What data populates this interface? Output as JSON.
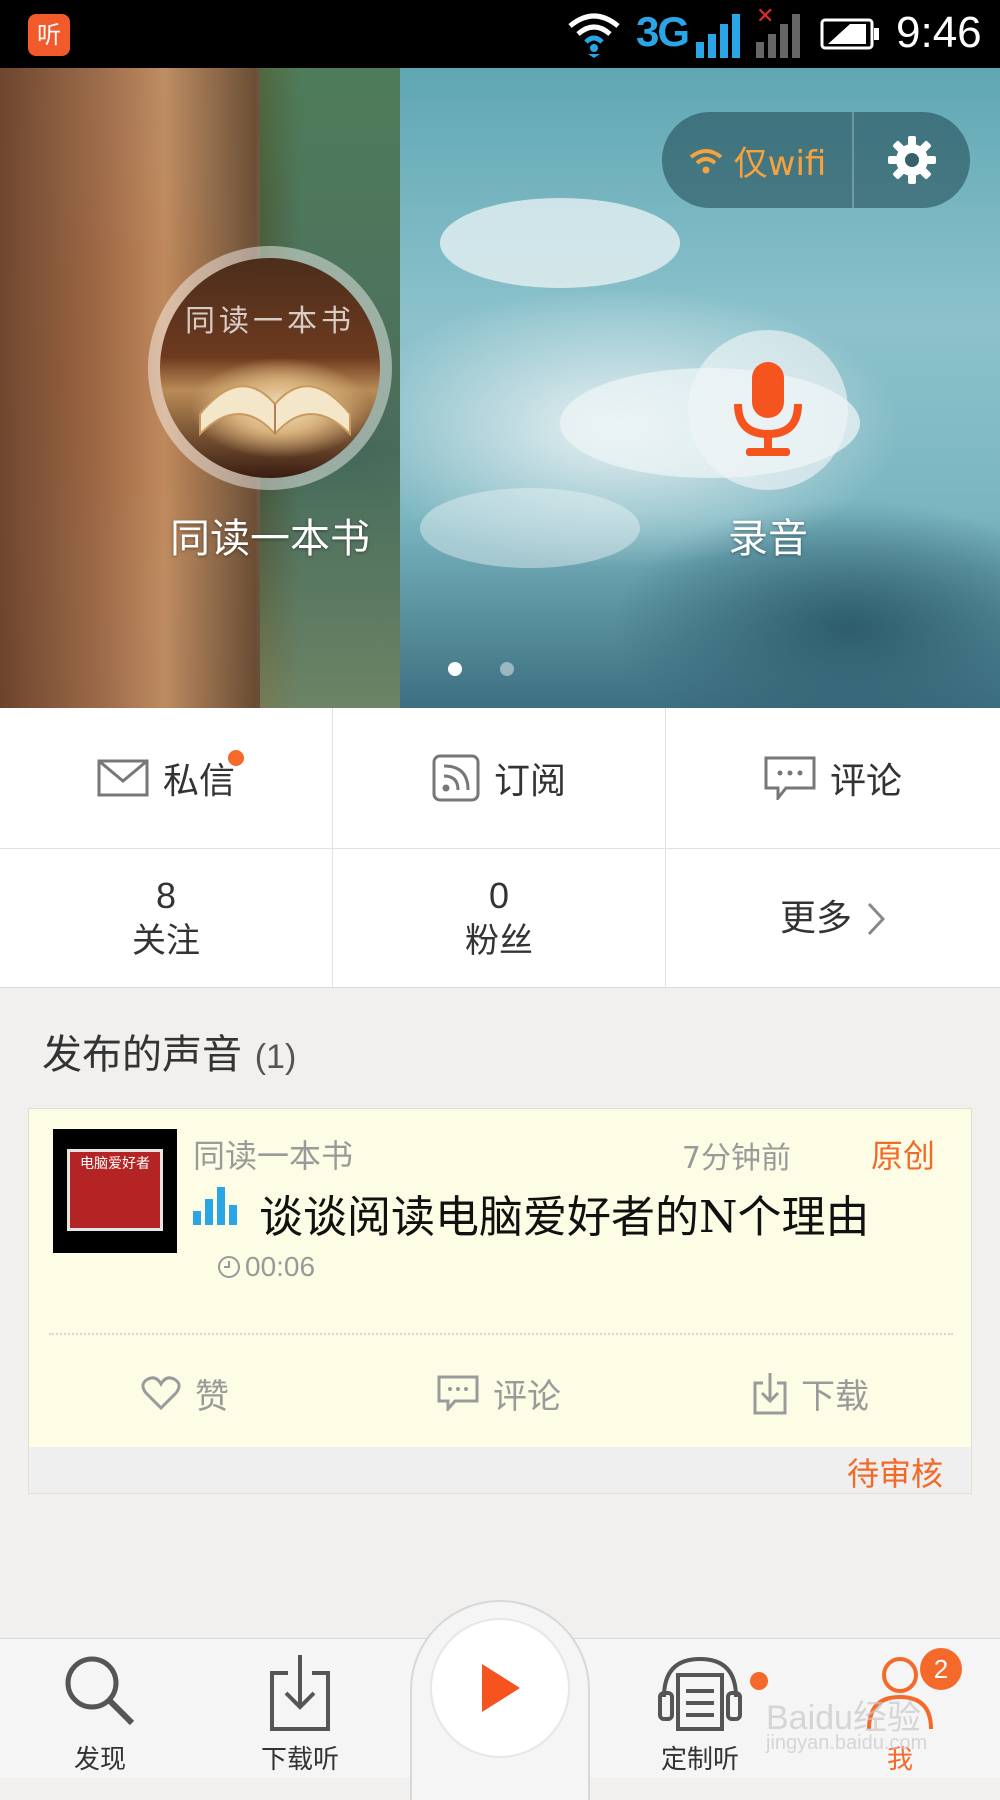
{
  "status_bar": {
    "app_icon_glyph": "听",
    "network": "3G",
    "time": "9:46"
  },
  "hero": {
    "wifi_only_label": "仅wifi",
    "username": "同读一本书",
    "avatar_text": "同读一本书",
    "record_label": "录音",
    "page_indicator": {
      "total": 2,
      "active": 1
    }
  },
  "actions": {
    "messages": "私信",
    "subscribe": "订阅",
    "comments": "评论"
  },
  "stats": {
    "following_count": "8",
    "following_label": "关注",
    "fans_count": "0",
    "fans_label": "粉丝",
    "more_label": "更多"
  },
  "published": {
    "title": "发布的声音",
    "count": "(1)",
    "items": [
      {
        "author": "同读一本书",
        "time_ago": "7分钟前",
        "original_tag": "原创",
        "title": "谈谈阅读电脑爱好者的N个理由",
        "duration": "00:06",
        "like_label": "赞",
        "comment_label": "评论",
        "download_label": "下载",
        "status": "待审核",
        "cover_text": "电脑爱好者"
      }
    ]
  },
  "bottom_nav": {
    "discover": "发现",
    "downloads": "下载听",
    "custom": "定制听",
    "me": "我",
    "me_badge": "2"
  },
  "watermark": {
    "line1": "Baidu经验",
    "line2": "jingyan.baidu.com"
  },
  "colors": {
    "accent": "#f56a2a",
    "wifi": "#f7a23b",
    "card_bg": "#fdfde5",
    "page_bg": "#f1f0ee"
  }
}
